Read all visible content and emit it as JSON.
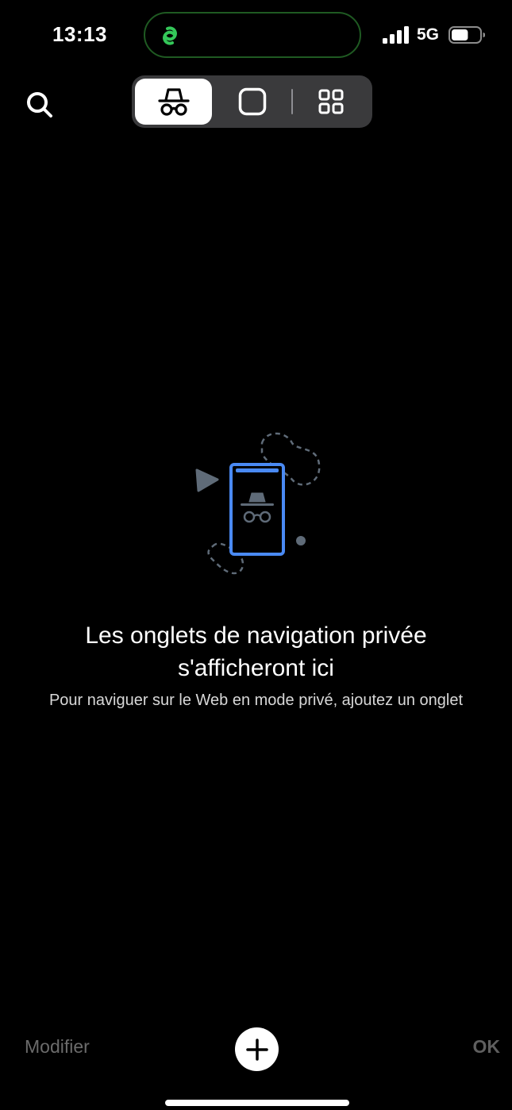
{
  "status_bar": {
    "time": "13:13",
    "network": "5G",
    "battery_level": 0.6,
    "signal_bars": 4,
    "island_icon": "chain-link-icon",
    "island_icon_color": "#34c759"
  },
  "top_bar": {
    "search_icon": "search-icon",
    "segments": [
      {
        "icon": "incognito-icon",
        "selected": true
      },
      {
        "icon": "single-tab-icon",
        "selected": false
      },
      {
        "icon": "tab-grid-icon",
        "selected": false
      }
    ]
  },
  "empty_state": {
    "illustration": "incognito-phone-illustration",
    "title_line1": "Les onglets de navigation privée",
    "title_line2": "s'afficheront ici",
    "subtitle": "Pour naviguer sur le Web en mode privé, ajoutez un onglet"
  },
  "bottom_bar": {
    "modify_label": "Modifier",
    "add_icon": "plus-icon",
    "ok_label": "OK"
  },
  "colors": {
    "background": "#000000",
    "accent_blue": "#4a8af4",
    "illustration_gray": "#5f6b78",
    "disabled_text": "#6b6b6b"
  }
}
